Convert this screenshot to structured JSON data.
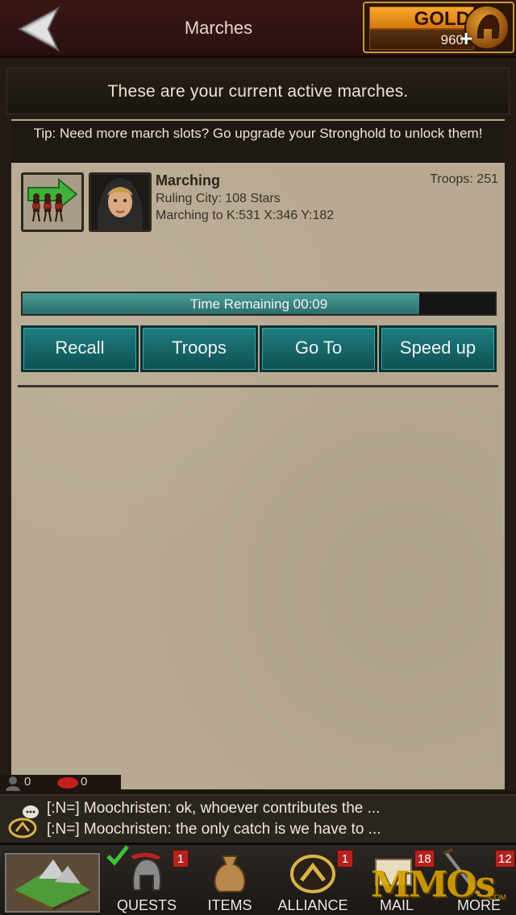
{
  "topbar": {
    "title": "Marches",
    "gold_label": "GOLD",
    "gold_amount": "960",
    "gold_plus": "+"
  },
  "header": {
    "text": "These are your current active marches."
  },
  "tip": {
    "text": "Tip: Need more march slots? Go upgrade your Stronghold to unlock them!"
  },
  "march": {
    "status": "Marching",
    "ruling_city": "Ruling City: 108 Stars",
    "destination": "Marching to K:531 X:346 Y:182",
    "troops": "Troops: 251",
    "time_remaining": "Time Remaining 00:09",
    "progress": 0.84
  },
  "actions": {
    "recall": "Recall",
    "troops": "Troops",
    "goto": "Go To",
    "speedup": "Speed up"
  },
  "counters": {
    "players": "0",
    "messages": "0"
  },
  "chat": {
    "lines": [
      "[:N=] Moochristen: ok, whoever contributes the ...",
      "[:N=] Moochristen: the only catch is we have to ..."
    ]
  },
  "nav": {
    "quests": "QUESTS",
    "quests_badge": "1",
    "items": "ITEMS",
    "alliance": "ALLIANCE",
    "alliance_badge": "1",
    "mail": "MAIL",
    "mail_badge": "18",
    "more": "MORE",
    "more_badge": "12"
  },
  "watermark": {
    "text": "MMOs",
    "sub": ".COM"
  }
}
